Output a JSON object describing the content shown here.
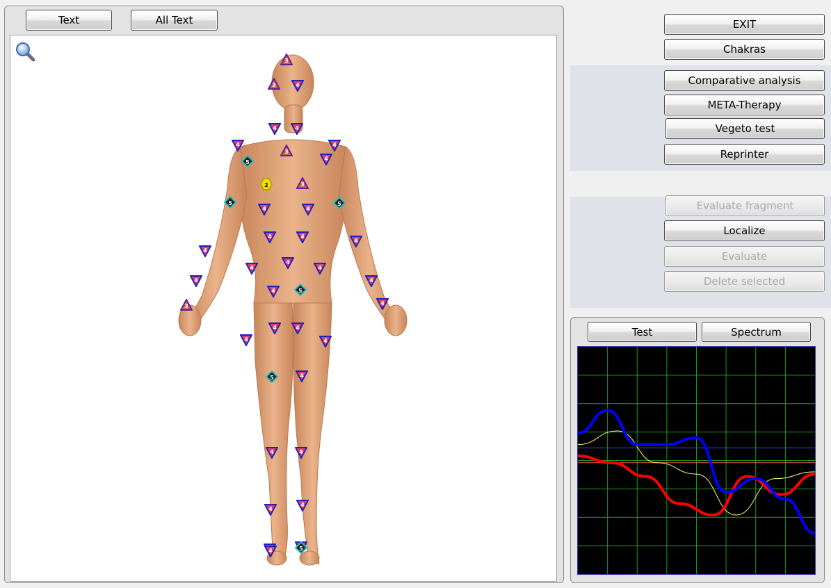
{
  "toolbar": {
    "text_button": "Text",
    "all_text_button": "All Text"
  },
  "menu": {
    "exit": "EXIT",
    "chakras": "Chakras",
    "comparative_analysis": "Comparative analysis",
    "meta_therapy": "META-Therapy",
    "vegeto_test": "Vegeto test",
    "reprinter": "Reprinter"
  },
  "fragment": {
    "evaluate_fragment": "Evaluate fragment",
    "localize": "Localize",
    "evaluate": "Evaluate",
    "delete_selected": "Delete selected"
  },
  "graph": {
    "test_button": "Test",
    "spectrum_button": "Spectrum"
  },
  "icons": {
    "zoom": "magnifier-icon"
  },
  "colors": {
    "marker4": "#2020c0",
    "marker3": "#c03030",
    "marker5": "#20c0c0",
    "marker2": "#f0e000",
    "blue_line": "#0000ff",
    "red_line": "#ff0000",
    "yellow_line": "#ffff80"
  },
  "markers": [
    {
      "type": "tri-up",
      "level": "3"
    },
    {
      "type": "tri-up",
      "level": "3"
    },
    {
      "type": "tri-down",
      "level": "4"
    },
    {
      "type": "tri-down",
      "level": "4"
    },
    {
      "type": "tri-down",
      "level": "4"
    },
    {
      "type": "tri-down",
      "level": "4"
    },
    {
      "type": "tri-up",
      "level": "3"
    },
    {
      "type": "tri-down",
      "level": "4"
    },
    {
      "type": "diamond",
      "level": "5"
    },
    {
      "type": "tri-down",
      "level": "4"
    },
    {
      "type": "hexagon",
      "level": "2"
    },
    {
      "type": "tri-up",
      "level": "3"
    },
    {
      "type": "diamond",
      "level": "5"
    },
    {
      "type": "diamond",
      "level": "5"
    },
    {
      "type": "tri-down",
      "level": "4"
    },
    {
      "type": "tri-down",
      "level": "4"
    },
    {
      "type": "tri-down",
      "level": "4"
    },
    {
      "type": "tri-down",
      "level": "4"
    },
    {
      "type": "tri-down",
      "level": "4"
    },
    {
      "type": "tri-down",
      "level": "4"
    },
    {
      "type": "tri-down",
      "level": "4"
    },
    {
      "type": "tri-down",
      "level": "4"
    },
    {
      "type": "tri-down",
      "level": "4"
    },
    {
      "type": "tri-down",
      "level": "4"
    },
    {
      "type": "tri-down",
      "level": "4"
    },
    {
      "type": "diamond",
      "level": "5"
    },
    {
      "type": "tri-down",
      "level": "4"
    },
    {
      "type": "tri-up",
      "level": "3"
    },
    {
      "type": "tri-down",
      "level": "4"
    },
    {
      "type": "tri-down",
      "level": "4"
    },
    {
      "type": "tri-down",
      "level": "4"
    },
    {
      "type": "tri-down",
      "level": "4"
    },
    {
      "type": "tri-down",
      "level": "4"
    },
    {
      "type": "tri-down",
      "level": "4"
    },
    {
      "type": "diamond",
      "level": "5"
    },
    {
      "type": "tri-down",
      "level": "4"
    },
    {
      "type": "tri-down",
      "level": "4"
    },
    {
      "type": "tri-down",
      "level": "4"
    },
    {
      "type": "tri-down",
      "level": "4"
    },
    {
      "type": "tri-down",
      "level": "4"
    },
    {
      "type": "tri-down",
      "level": "4"
    },
    {
      "type": "tri-down",
      "level": "4"
    },
    {
      "type": "diamond",
      "level": "5"
    }
  ],
  "chart_data": {
    "type": "line",
    "grid": true,
    "series": [
      {
        "color": "blue",
        "values": [
          0.62,
          0.72,
          0.57,
          0.57,
          0.6,
          0.36,
          0.42,
          0.33,
          0.18
        ]
      },
      {
        "color": "red",
        "values": [
          0.52,
          0.49,
          0.43,
          0.31,
          0.26,
          0.43,
          0.35,
          0.44
        ]
      },
      {
        "color": "yellow",
        "values": [
          0.57,
          0.63,
          0.49,
          0.44,
          0.26,
          0.42,
          0.45
        ]
      }
    ]
  }
}
